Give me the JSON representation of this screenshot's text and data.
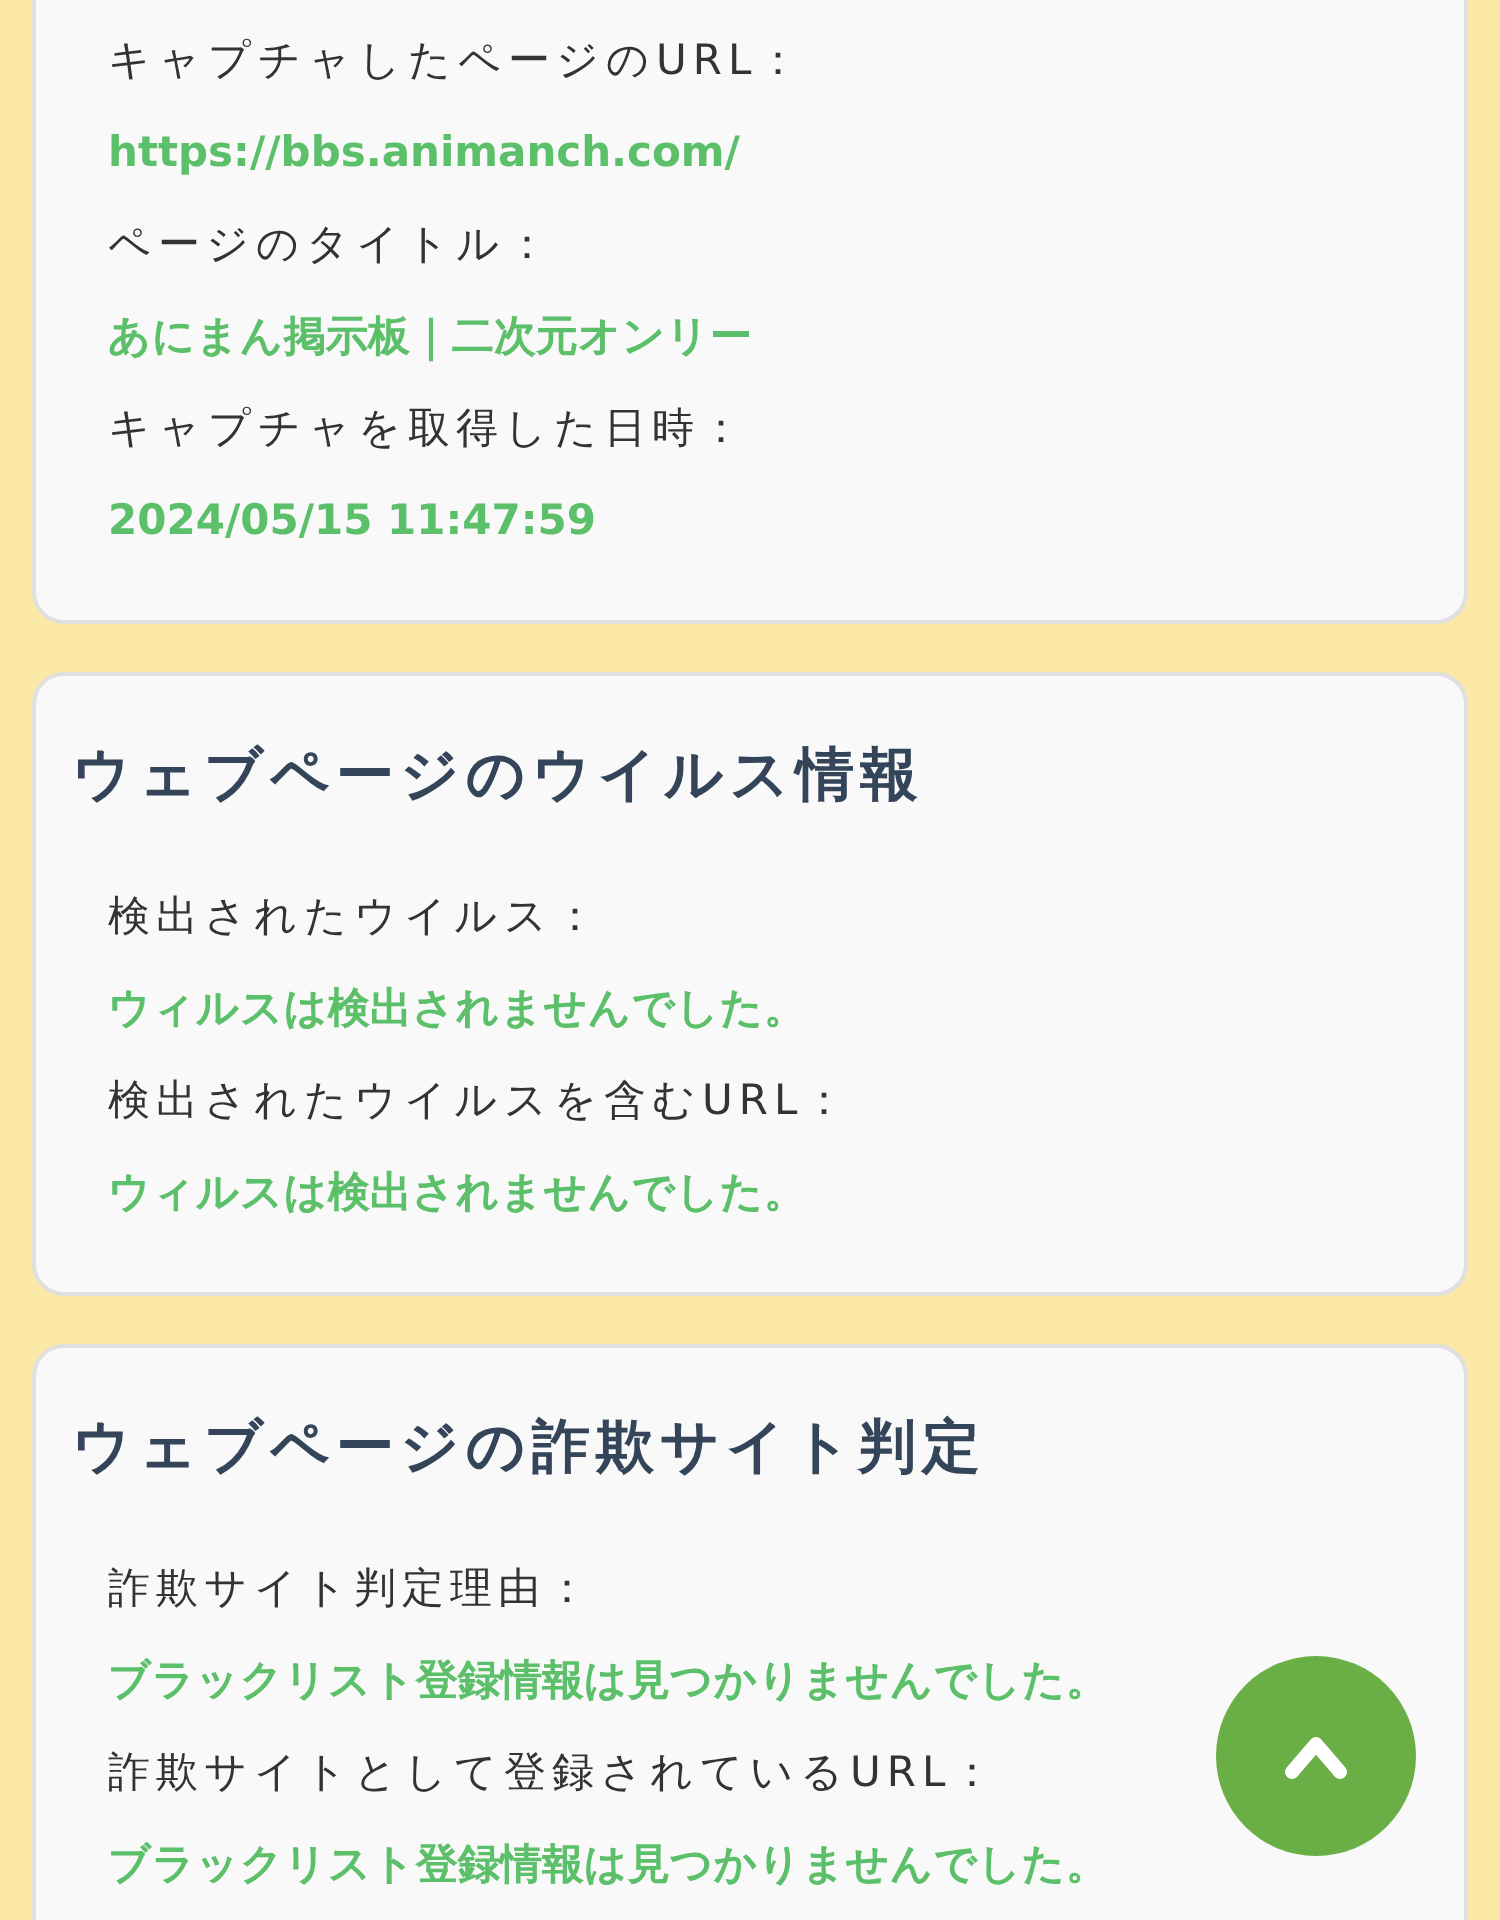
{
  "sections": [
    {
      "fields": [
        {
          "label": "キャプチャしたページのURL：",
          "value": "https://bbs.animanch.com/"
        },
        {
          "label": "ページのタイトル：",
          "value": "あにまん掲示板｜二次元オンリー"
        },
        {
          "label": "キャプチャを取得した日時：",
          "value": "2024/05/15 11:47:59"
        }
      ]
    },
    {
      "title": "ウェブページのウイルス情報",
      "fields": [
        {
          "label": "検出されたウイルス：",
          "value": "ウィルスは検出されませんでした。"
        },
        {
          "label": "検出されたウイルスを含むURL：",
          "value": "ウィルスは検出されませんでした。"
        }
      ]
    },
    {
      "title": "ウェブページの詐欺サイト判定",
      "fields": [
        {
          "label": "詐欺サイト判定理由：",
          "value": "ブラックリスト登録情報は見つかりませんでした。"
        },
        {
          "label": "詐欺サイトとして登録されているURL：",
          "value": "ブラックリスト登録情報は見つかりませんでした。"
        }
      ]
    }
  ]
}
